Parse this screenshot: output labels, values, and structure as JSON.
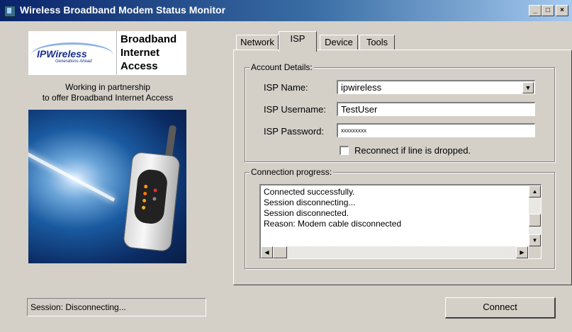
{
  "window": {
    "title": "Wireless Broadband Modem Status Monitor",
    "controls": {
      "minimize": "_",
      "maximize": "□",
      "close": "×"
    }
  },
  "branding": {
    "logo_text": "IPWireless",
    "logo_tagline": "Generations Ahead",
    "product_line1": "Broadband",
    "product_line2": "Internet",
    "product_line3": "Access",
    "partner_line1": "Working in partnership",
    "partner_line2": "to offer Broadband Internet Access"
  },
  "tabs": [
    {
      "label": "Network"
    },
    {
      "label": "ISP"
    },
    {
      "label": "Device"
    },
    {
      "label": "Tools"
    }
  ],
  "active_tab": "ISP",
  "account": {
    "group_label": "Account Details:",
    "isp_name_label": "ISP Name:",
    "isp_name_value": "ipwireless",
    "isp_username_label": "ISP Username:",
    "isp_username_value": "TestUser",
    "isp_password_label": "ISP Password:",
    "isp_password_value": "xxxxxxxxx",
    "reconnect_label": "Reconnect if line is dropped.",
    "reconnect_checked": false
  },
  "progress": {
    "group_label": "Connection progress:",
    "lines": [
      "Connected successfully.",
      "Session disconnecting...",
      "Session disconnected.",
      "Reason: Modem cable disconnected"
    ]
  },
  "status_text": "Session: Disconnecting...",
  "connect_label": "Connect",
  "colors": {
    "titlebar_start": "#0a246a",
    "titlebar_end": "#a6caf0",
    "face": "#d4d0c8",
    "logo_blue": "#1a2f8c"
  }
}
